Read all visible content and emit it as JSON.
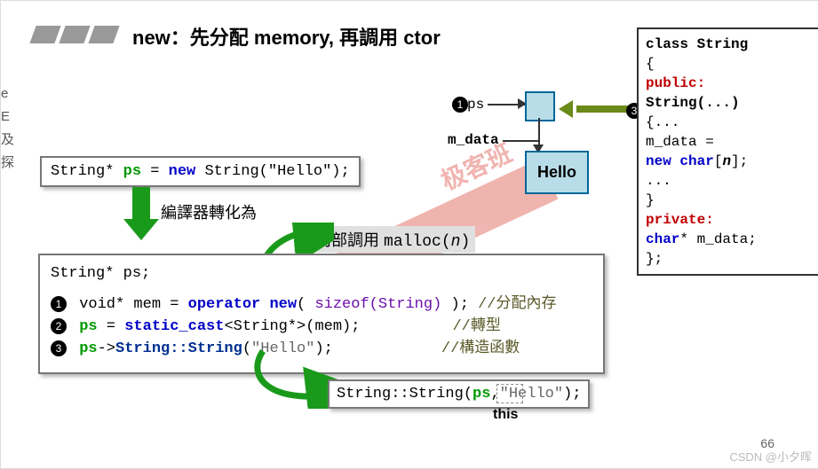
{
  "title": "new：先分配 memory, 再調用 ctor",
  "sidebar": [
    "e",
    "E",
    "及",
    "探"
  ],
  "code_line_1": {
    "pre": "String* ",
    "ps": "ps",
    "mid": " = ",
    "new_kw": "new",
    "rest": " String(\"Hello\");"
  },
  "translate_label": "編譯器轉化為",
  "internal_label_a": "其內部調用 ",
  "internal_label_b": "malloc(",
  "internal_label_c": "n",
  "internal_label_d": ")",
  "code_block": {
    "decl": "String* ps;",
    "l1a": "void* mem = ",
    "l1b": "operator new",
    "l1c": "( ",
    "l1d": "sizeof",
    "l1e": "(String)",
    "l1f": " ); ",
    "l1cmt": "//分配內存",
    "l2a": "ps",
    "l2b": " = ",
    "l2c": "static_cast",
    "l2d": "<String*>(mem);",
    "l2cmt": "//轉型",
    "l3a": "ps",
    "l3b": "->",
    "l3c": "String::String",
    "l3d": "(",
    "l3e": "\"Hello\"",
    "l3f": ");",
    "l3cmt": "//構造函數"
  },
  "call_line": {
    "a": "String::String(",
    "b": "ps",
    "c": ",",
    "d": "\"Hello\"",
    "e": ");"
  },
  "this_label": "this",
  "diagram": {
    "ps_label": "ps",
    "mdata_label": "m_data",
    "hello": "Hello"
  },
  "class_code": {
    "l1": "class String",
    "l2": "{",
    "l3": "public:",
    "l4a": "  String(...)",
    "l5": "  {...",
    "l6a": "    m_data =",
    "l7a": "    ",
    "l7b": "new",
    "l7c": " ",
    "l7d": "char",
    "l7e": "[",
    "l7f": "n",
    "l7g": "];",
    "l8": "    ...",
    "l9": "  }",
    "l10": "private:",
    "l11a": "  ",
    "l11b": "char",
    "l11c": "* m_data;",
    "l12": "};"
  },
  "page_num": "66",
  "csdn": "CSDN @小夕晖",
  "watermark": "极客班"
}
